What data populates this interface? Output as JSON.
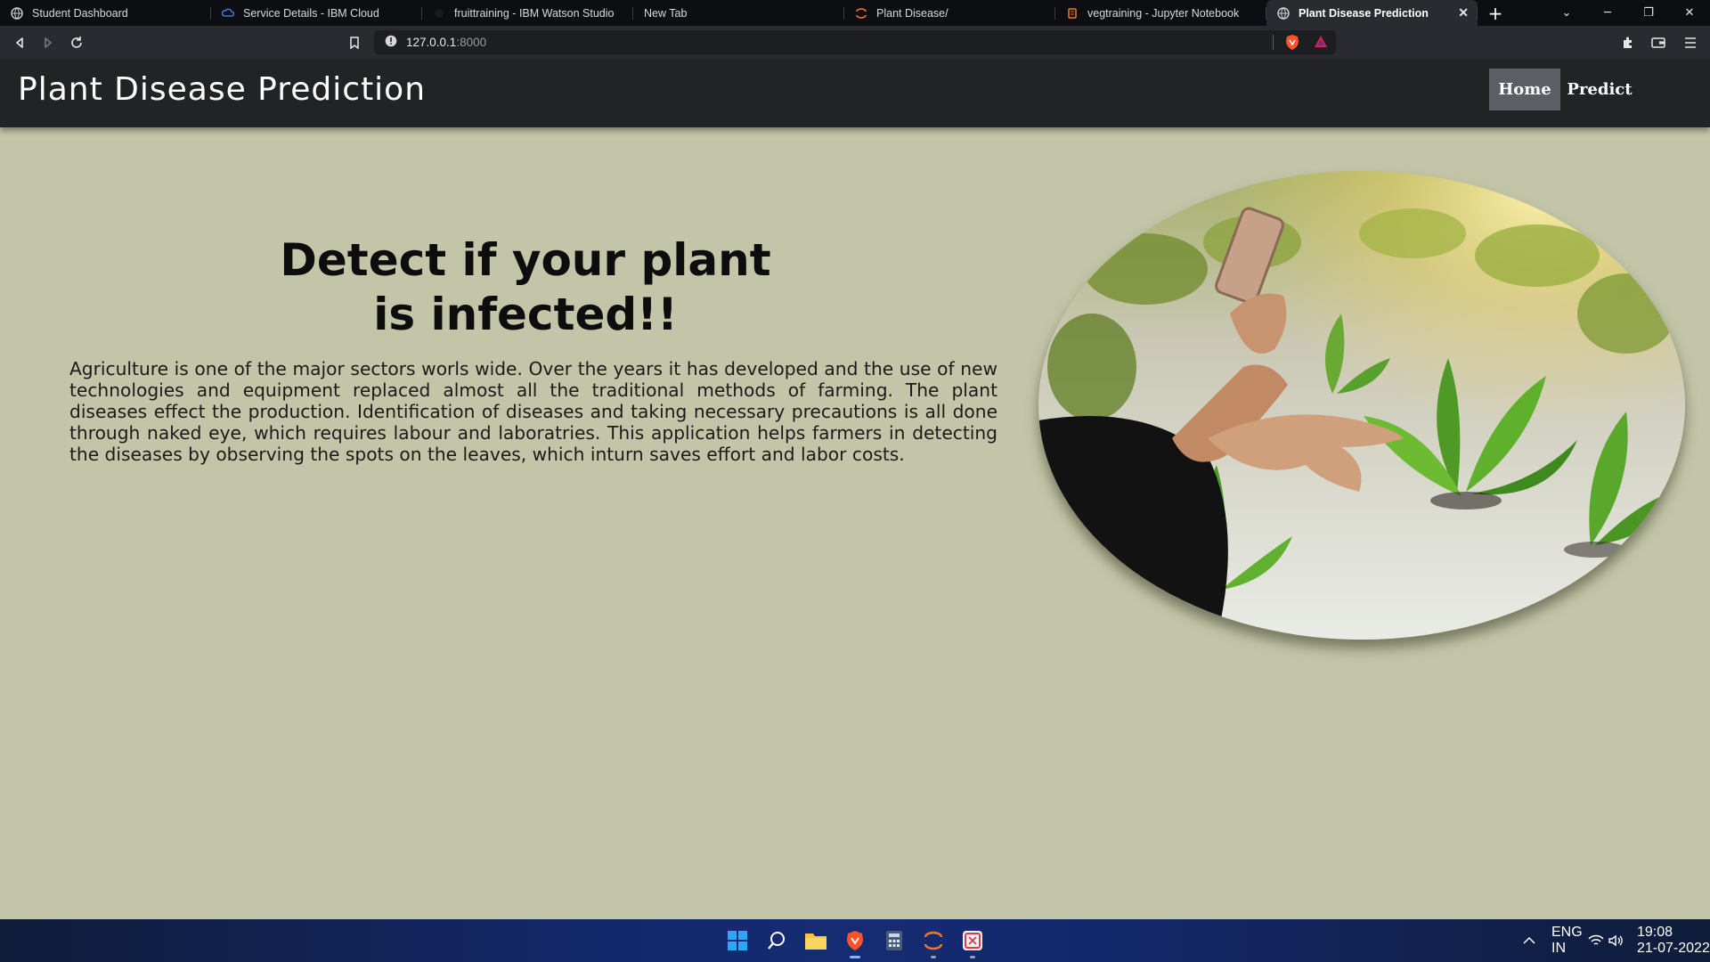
{
  "browser": {
    "tabs": [
      {
        "title": "Student Dashboard",
        "active": false,
        "icon": "globe-icon"
      },
      {
        "title": "Service Details - IBM Cloud",
        "active": false,
        "icon": "ibm-cloud-icon"
      },
      {
        "title": "fruittraining - IBM Watson Studio",
        "active": false,
        "icon": "watson-icon"
      },
      {
        "title": "New Tab",
        "active": false,
        "icon": ""
      },
      {
        "title": "Plant Disease/",
        "active": false,
        "icon": "jupyter-icon"
      },
      {
        "title": "vegtraining - Jupyter Notebook",
        "active": false,
        "icon": "notebook-icon"
      },
      {
        "title": "Plant Disease Prediction",
        "active": true,
        "icon": "globe-icon"
      }
    ],
    "url": {
      "host": "127.0.0.1",
      "port": ":8000"
    }
  },
  "site": {
    "title": "Plant Disease Prediction",
    "nav": {
      "home": "Home",
      "predict": "Predict"
    }
  },
  "hero": {
    "title_line1": "Detect if your plant",
    "title_line2": "is infected!!",
    "body": "Agriculture is one of the major sectors worls wide. Over the years it has developed and the use of new technologies and equipment replaced almost all the traditional methods of farming. The plant diseases effect the production. Identification of diseases and taking necessary precautions is all done through naked eye, which requires labour and laboratries. This application helps farmers in detecting the diseases by observing the spots on the leaves, which inturn saves effort and labor costs."
  },
  "taskbar": {
    "lang_line1": "ENG",
    "lang_line2": "IN",
    "time": "19:08",
    "date": "21-07-2022"
  },
  "colors": {
    "page_background": "#c2c5a7",
    "header_background": "#222325",
    "active_nav": "#5b5e64"
  }
}
